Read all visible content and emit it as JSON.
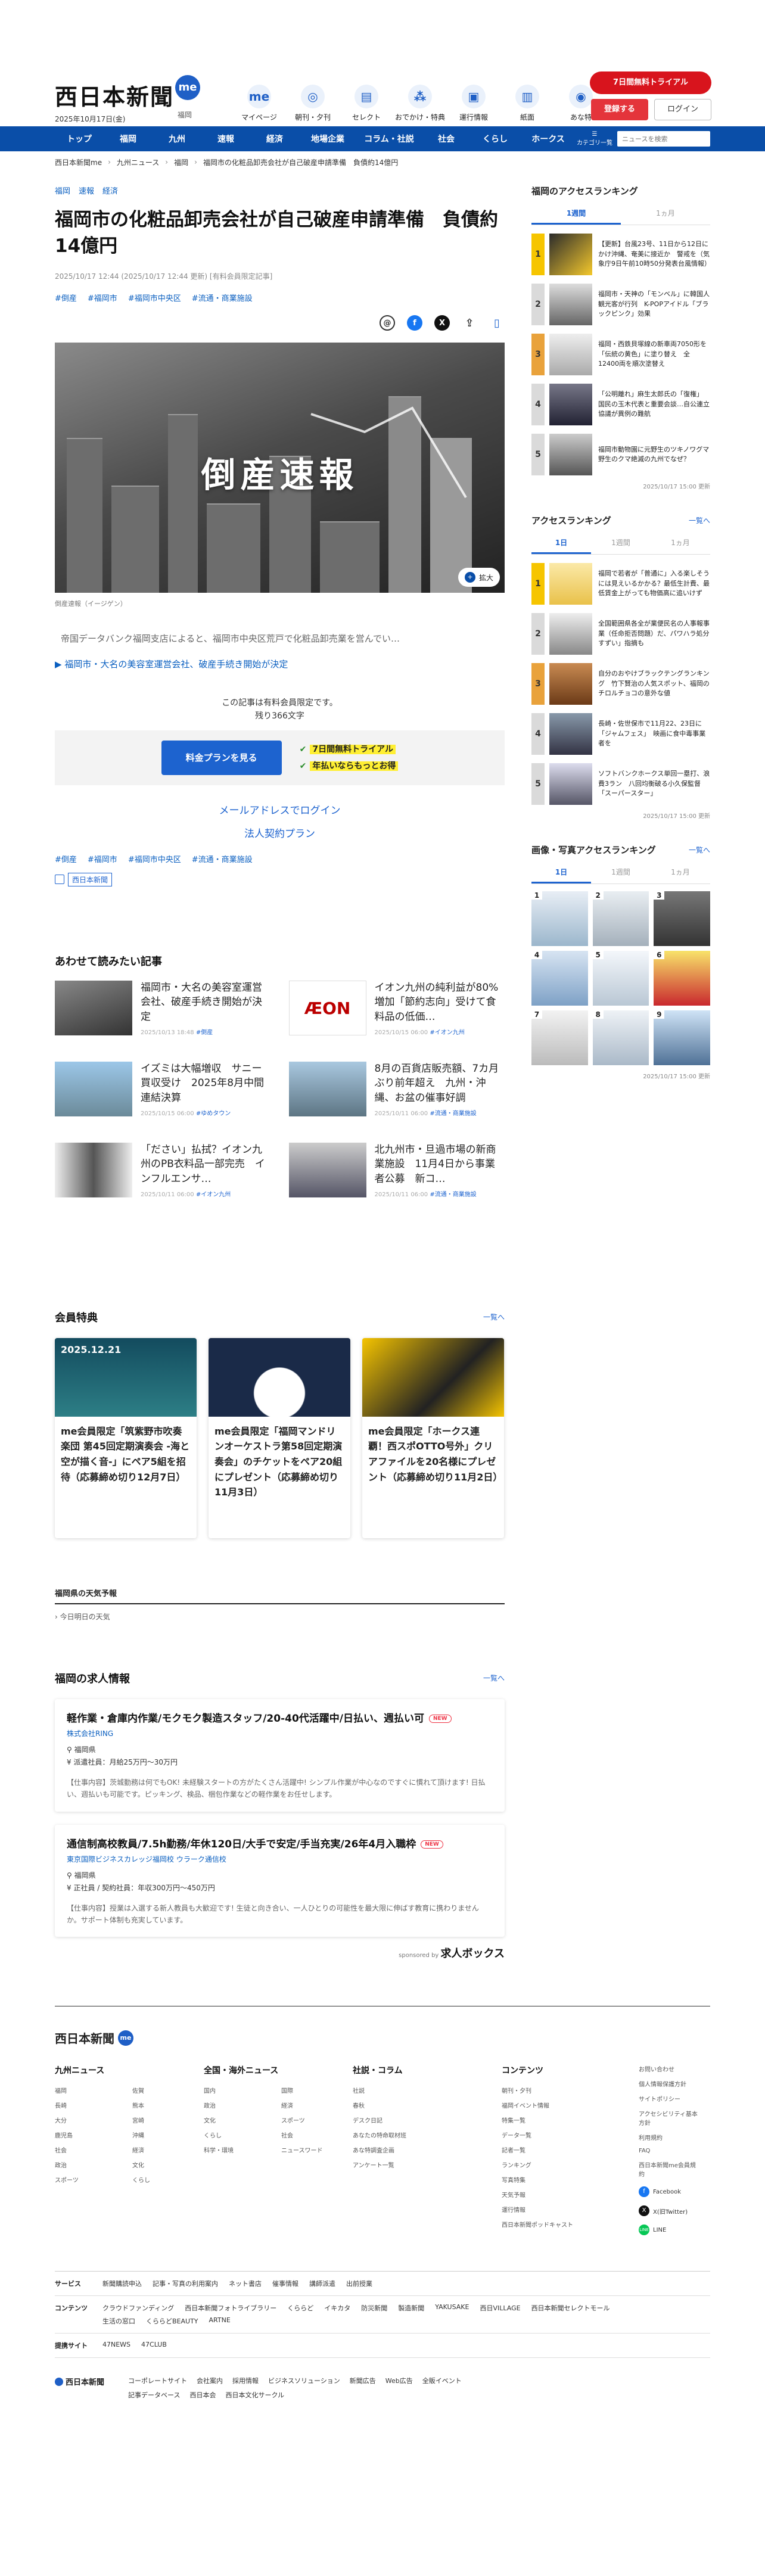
{
  "header": {
    "logo": "西日本新聞",
    "logo_badge": "me",
    "date": "2025年10月17日(金)",
    "area": "福岡",
    "nav": [
      {
        "label": "マイページ",
        "icon": "me-icon"
      },
      {
        "label": "朝刊・夕刊",
        "icon": "newspaper-icon"
      },
      {
        "label": "セレクト",
        "icon": "select-icon"
      },
      {
        "label": "おでかけ・特典",
        "icon": "footprint-icon"
      },
      {
        "label": "運行情報",
        "icon": "train-icon"
      },
      {
        "label": "紙面",
        "icon": "paper-icon"
      },
      {
        "label": "あな特",
        "icon": "owl-icon"
      }
    ],
    "trial_label": "7日間無料トライアル",
    "register_label": "登録する",
    "login_label": "ログイン"
  },
  "navbar": {
    "items": [
      "トップ",
      "福岡",
      "九州",
      "速報",
      "経済",
      "地場企業",
      "コラム・社説",
      "社会",
      "くらし",
      "ホークス"
    ],
    "category_label": "カテゴリ一覧",
    "search_placeholder": "ニュースを検索"
  },
  "breadcrumbs": [
    "西日本新聞me",
    "九州ニュース",
    "福岡",
    "福岡市の化粧品卸売会社が自己破産申請準備　負債約14億円"
  ],
  "article": {
    "top_tags": [
      "福岡",
      "速報",
      "経済"
    ],
    "title": "福岡市の化粧品卸売会社が自己破産申請準備　負債約14億円",
    "meta": "2025/10/17 12:44 (2025/10/17 12:44 更新) [有料会員限定記事]",
    "hashtags": [
      "#倒産",
      "#福岡市",
      "#福岡市中央区",
      "#流通・商業施設"
    ],
    "hero_text": "倒産速報",
    "zoom_label": "拡大",
    "caption": "倒産速報（イージゲン）",
    "lead": "帝国データバンク福岡支店によると、福岡市中央区荒戸で化粧品卸売業を営んでい…",
    "related_link": "福岡市・大名の美容室運営会社、破産手続き開始が決定",
    "paywall_line1": "この記事は有料会員限定です。",
    "paywall_line2": "残り366文字",
    "plan_button": "料金プランを見る",
    "feature1": "7日間無料トライアル",
    "feature2": "年払いならもっとお得",
    "mail_login": "メールアドレスでログイン",
    "corp_contract": "法人契約プラン",
    "badge_label": "西日本新聞"
  },
  "recommended": {
    "title": "あわせて読みたい記事",
    "items": [
      {
        "title": "福岡市・大名の美容室運営会社、破産手続き開始が決定",
        "meta": "2025/10/13 18:48",
        "tag": "#倒産"
      },
      {
        "title": "イオン九州の純利益が80%増加「節約志向」受けて食料品の低価…",
        "meta": "2025/10/15 06:00",
        "tag": "#イオン九州"
      },
      {
        "title": "イズミは大幅増収　サニー買収受け　2025年8月中間連結決算",
        "meta": "2025/10/15 06:00",
        "tag": "#ゆめタウン"
      },
      {
        "title": "8月の百貨店販売額、7カ月ぶり前年超え　九州・沖縄、お盆の催事好調",
        "meta": "2025/10/11 06:00",
        "tag": "#流通・商業施設"
      },
      {
        "title": "「ださい」払拭？イオン九州のPB衣料品一部完売　インフルエンサ…",
        "meta": "2025/10/11 06:00",
        "tag": "#イオン九州"
      },
      {
        "title": "北九州市・旦過市場の新商業施設　11月4日から事業者公募　新コ…",
        "meta": "2025/10/11 06:00",
        "tag": "#流通・商業施設"
      }
    ]
  },
  "benefits": {
    "title": "会員特典",
    "more": "一覧へ",
    "items": [
      {
        "title": "me会員限定「筑紫野市吹奏楽団 第45回定期演奏会 -海と空が描く音-」にペア5組を招待（応募締め切り12月7日）",
        "img_text": "2025.12.21"
      },
      {
        "title": "me会員限定「福岡マンドリンオーケストラ第58回定期演奏会」のチケットをペア20組にプレゼント（応募締め切り11月3日）",
        "img_text": ""
      },
      {
        "title": "me会員限定「ホークス連覇！西スポOTTO号外」クリアファイルを20名様にプレゼント（応募締め切り11月2日）",
        "img_text": ""
      }
    ]
  },
  "weather": {
    "title": "福岡県の天気予報",
    "sub": "今日明日の天気"
  },
  "jobs": {
    "title": "福岡の求人情報",
    "more": "一覧へ",
    "new_label": "NEW",
    "items": [
      {
        "title": "軽作業・倉庫内作業/モクモク製造スタッフ/20-40代活躍中/日払い、週払い可",
        "company": "株式会社RING",
        "location": "福岡県",
        "salary": "派遣社員：月給25万円〜30万円",
        "desc": "【仕事内容】茨城勤務は何でもOK! 未経験スタートの方がたくさん活躍中! シンプル作業が中心なのですぐに慣れて頂けます! 日払い、週払いも可能です。ピッキング、検品、梱包作業などの軽作業をお任せします。"
      },
      {
        "title": "通信制高校教員/7.5h勤務/年休120日/大手で安定/手当充実/26年4月入職枠",
        "company": "東京国際ビジネスカレッジ福岡校 ウラーク通信校",
        "location": "福岡県",
        "salary": "正社員 / 契約社員：年収300万円〜450万円",
        "desc": "【仕事内容】授業は入選する新人教員も大歓迎です! 生徒と向き合い、一人ひとりの可能性を最大限に伸ばす教育に携わりませんか。サポート体制も充実しています。"
      }
    ],
    "sponsor_label": "sponsored by",
    "sponsor_name": "求人ボックス"
  },
  "sidebar": {
    "ranking1": {
      "title": "福岡のアクセスランキング",
      "tabs": [
        "1週間",
        "1ヵ月"
      ],
      "items": [
        "【更新】台風23号、11日から12日にかけ沖縄、奄美に接近か　警戒を（気象庁9日午前10時50分発表台風情報）",
        "福岡市・天神の「モンベル」に韓国人観光客が行列　K-POPアイドル「ブラックピンク」効果",
        "福岡・西鉄貝塚線の新車両7050形を「伝統の黄色」に塗り替え　全12400両を順次塗替え",
        "「公明離れ」麻生太郎氏の「復権」　国民の玉木代表と重要会談…自公連立協議が異例の難航",
        "福岡市動物園に元野生のツキノワグマ　野生のクマ絶滅の九州でなぜ？"
      ],
      "date": "2025/10/17 15:00 更新"
    },
    "ranking2": {
      "title": "アクセスランキング",
      "more": "一覧へ",
      "tabs": [
        "1日",
        "1週間",
        "1ヵ月"
      ],
      "items": [
        "福岡で若者が「普通に」入る楽しそうには見えいるかかる？最低生計費、最低賃金上がっても物価高に追いけず",
        "全国範囲県各全が業便民名の人事報事業（任命拒否問題）だ、パワハラ処分すずい」指摘も",
        "自分のおやけブラックテングランキング　竹下賢治の人気スポット、福岡のチロルチョコの意外な値",
        "長崎・佐世保市で11月22、23日に「ジャムフェス」　映画に食中毒事業者を",
        "ソフトバンクホークス単回一塁打、浪費3ラン　八回均衡破る小久保監督「スーパースター」"
      ],
      "date": "2025/10/17 15:00 更新"
    },
    "ranking3": {
      "title": "画像・写真アクセスランキング",
      "more": "一覧へ",
      "tabs": [
        "1日",
        "1週間",
        "1ヵ月"
      ],
      "date": "2025/10/17 15:00 更新"
    }
  },
  "footer": {
    "logo": "西日本新聞",
    "logo_badge": "me",
    "cols": [
      {
        "title": "九州ニュース",
        "items": [
          "福岡",
          "佐賀",
          "長崎",
          "熊本",
          "大分",
          "宮崎",
          "鹿児島",
          "沖縄",
          "社会",
          "経済",
          "政治",
          "文化",
          "スポーツ",
          "くらし"
        ]
      },
      {
        "title": "全国・海外ニュース",
        "items": [
          "国内",
          "国際",
          "政治",
          "経済",
          "文化",
          "スポーツ",
          "くらし",
          "社会",
          "科学・環境",
          "ニュースワード"
        ]
      },
      {
        "title": "社説・コラム",
        "items": [
          "社説",
          "春秋",
          "デスク日記",
          "あなたの特命取材班",
          "あな特調査企画",
          "アンケート一覧"
        ]
      },
      {
        "title": "コンテンツ",
        "items": [
          "朝刊・夕刊",
          "福岡イベント情報",
          "特集一覧",
          "データ一覧",
          "記者一覧",
          "ランキング",
          "写真特集",
          "天気予報",
          "運行情報",
          "西日本新聞ポッドキャスト"
        ]
      },
      {
        "title": "",
        "items": [
          "お問い合わせ",
          "個人情報保護方針",
          "サイトポリシー",
          "アクセシビリティ基本方針",
          "利用規約",
          "FAQ",
          "西日本新聞me会員規約"
        ]
      }
    ],
    "social": [
      "Facebook",
      "X(旧Twitter)",
      "LINE"
    ],
    "services": [
      {
        "label": "サービス",
        "items": [
          "新聞購読申込",
          "記事・写真の利用案内",
          "ネット書店",
          "催事情報",
          "講師派遣",
          "出前授業"
        ]
      },
      {
        "label": "コンテンツ",
        "items": [
          "クラウドファンディング",
          "西日本新聞フォトライブラリー",
          "くららど",
          "イキカタ",
          "防災新聞",
          "製造新聞",
          "YAKUSAKE",
          "西日VILLAGE",
          "西日本新聞セレクトモール",
          "生活の窓口",
          "くららどBEAUTY",
          "ARTNE"
        ]
      },
      {
        "label": "提携サイト",
        "items": [
          "47NEWS",
          "47CLUB"
        ]
      }
    ],
    "bottom_logo": "西日本新聞",
    "bottom_links": [
      "コーポレートサイト",
      "会社案内",
      "採用情報",
      "ビジネスソリューション",
      "新聞広告",
      "Web広告",
      "全販イベント",
      "記事データベース",
      "西日本会",
      "西日本文化サークル"
    ]
  },
  "colors": {
    "brand_blue": "#0a4ea8",
    "accent_red": "#d8141d",
    "link_blue": "#1d63cf"
  }
}
